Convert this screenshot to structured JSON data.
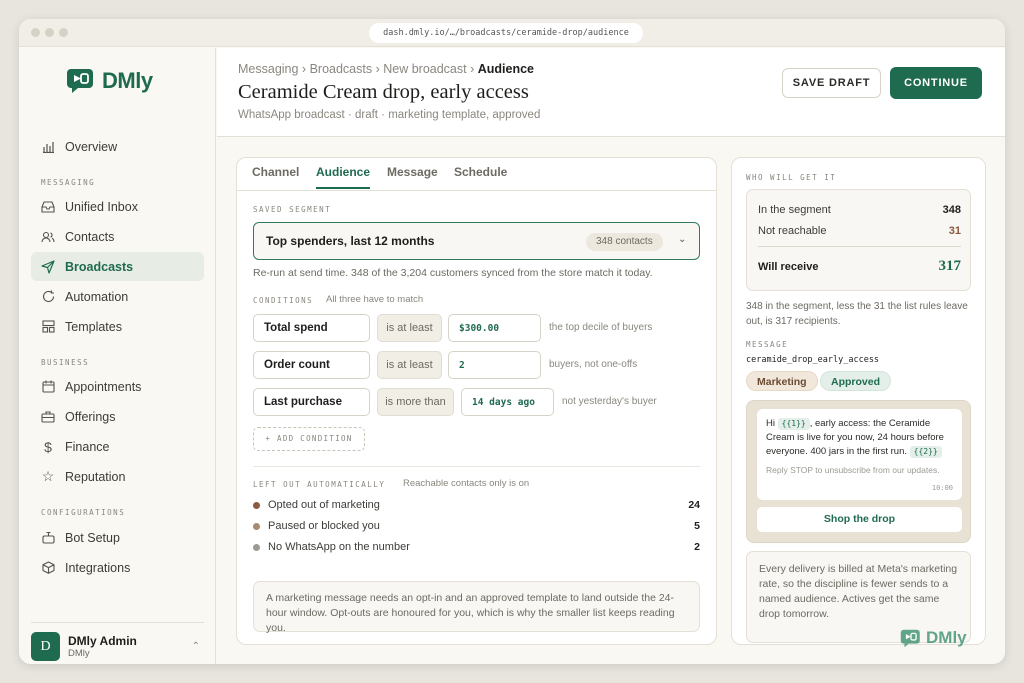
{
  "browser": {
    "url": "dash.dmly.io/…/broadcasts/ceramide-drop/audience"
  },
  "brand": {
    "name": "DMly",
    "accent": "#1f6b4f"
  },
  "sidebar": {
    "overview": "Overview",
    "sections": {
      "messaging": "MESSAGING",
      "business": "BUSINESS",
      "configurations": "CONFIGURATIONS"
    },
    "items": [
      {
        "label": "Unified Inbox",
        "icon": "inbox-icon"
      },
      {
        "label": "Contacts",
        "icon": "users-icon"
      },
      {
        "label": "Broadcasts",
        "icon": "send-icon"
      },
      {
        "label": "Automation",
        "icon": "refresh-icon"
      },
      {
        "label": "Templates",
        "icon": "layout-icon"
      },
      {
        "label": "Appointments",
        "icon": "calendar-icon"
      },
      {
        "label": "Offerings",
        "icon": "briefcase-icon"
      },
      {
        "label": "Finance",
        "icon": "dollar-icon"
      },
      {
        "label": "Reputation",
        "icon": "star-icon"
      },
      {
        "label": "Bot Setup",
        "icon": "bot-icon"
      },
      {
        "label": "Integrations",
        "icon": "cube-icon"
      }
    ],
    "user": {
      "initial": "D",
      "name": "DMly Admin",
      "sub": "DMly"
    }
  },
  "header": {
    "crumbs": [
      "Messaging ›",
      "Broadcasts ›",
      "New broadcast ›"
    ],
    "current": "Audience",
    "title": "Ceramide Cream drop, early access",
    "subtitle": "WhatsApp broadcast · draft · marketing template, approved",
    "save_label": "SAVE DRAFT",
    "continue_label": "CONTINUE"
  },
  "tabs": [
    "Channel",
    "Audience",
    "Message",
    "Schedule"
  ],
  "segment": {
    "label": "SAVED SEGMENT",
    "name": "Top spenders, last 12 months",
    "count": "348 contacts",
    "note": "Re-run at send time. 348 of the 3,204 customers synced from the store match it today."
  },
  "conditions": {
    "label": "CONDITIONS",
    "hint": "All three have to match",
    "rows": [
      {
        "field": "Total spend",
        "op": "is at least",
        "value": "$300.00",
        "note": "the top decile of buyers"
      },
      {
        "field": "Order count",
        "op": "is at least",
        "value": "2",
        "note": "buyers, not one-offs"
      },
      {
        "field": "Last purchase",
        "op": "is more than",
        "value": "14 days ago",
        "note": "not yesterday's buyer"
      }
    ],
    "add_label": "+ ADD CONDITION"
  },
  "excluded": {
    "label": "LEFT OUT AUTOMATICALLY",
    "hint": "Reachable contacts only is on",
    "rows": [
      {
        "label": "Opted out of marketing",
        "count": "24",
        "color": "#8b5a3c"
      },
      {
        "label": "Paused or blocked you",
        "count": "5",
        "color": "#a88a72"
      },
      {
        "label": "No WhatsApp on the number",
        "count": "2",
        "color": "#9c9a92"
      }
    ]
  },
  "info": "A marketing message needs an opt-in and an approved template to land outside the 24-hour window. Opt-outs are honoured for you, which is why the smaller list keeps reading you.",
  "summary": {
    "label": "WHO WILL GET IT",
    "in_segment_label": "In the segment",
    "in_segment": "348",
    "not_reachable_label": "Not reachable",
    "not_reachable": "31",
    "will_receive_label": "Will receive",
    "will_receive": "317",
    "note": "348 in the segment, less the 31 the list rules leave out, is 317 recipients.",
    "message_label": "MESSAGE",
    "template_name": "ceramide_drop_early_access",
    "tag_category": "Marketing",
    "tag_status": "Approved"
  },
  "preview": {
    "hi": "Hi",
    "var1": "{{1}}",
    "body": ", early access: the Ceramide Cream is live for you now, 24 hours before everyone. 400 jars in the first run.",
    "var2": "{{2}}",
    "footer": "Reply STOP to unsubscribe from our updates.",
    "time": "10:00",
    "button": "Shop the drop"
  },
  "billing": "Every delivery is billed at Meta's marketing rate, so the discipline is fewer sends to a named audience. Actives get the same drop tomorrow.",
  "watermark": "DMly"
}
